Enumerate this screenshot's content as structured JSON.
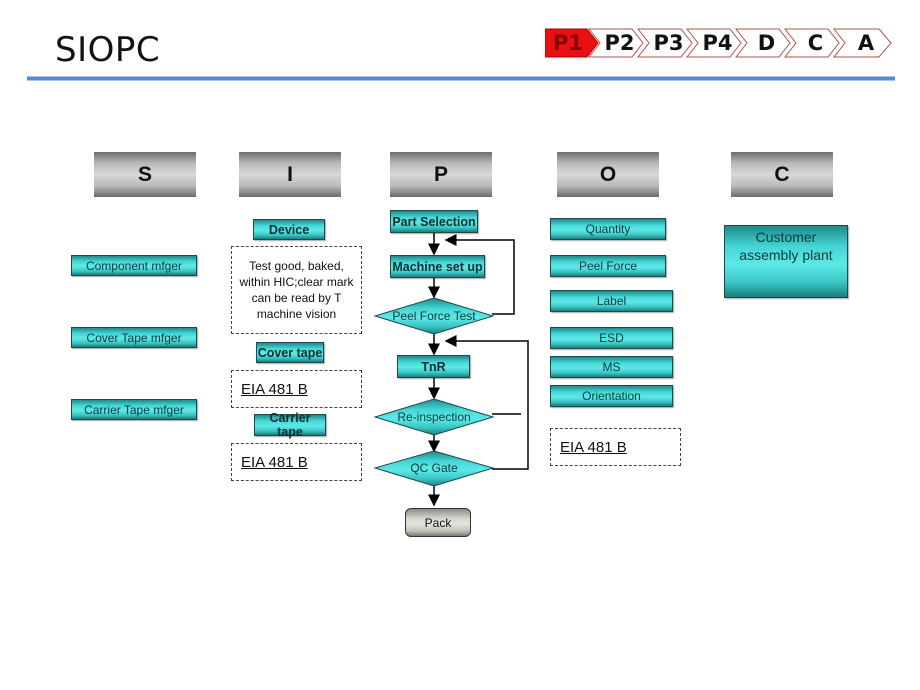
{
  "title": "SIOPC",
  "nav": {
    "items": [
      {
        "label": "P1",
        "active": true
      },
      {
        "label": "P2",
        "active": false
      },
      {
        "label": "P3",
        "active": false
      },
      {
        "label": "P4",
        "active": false
      },
      {
        "label": "D",
        "active": false
      },
      {
        "label": "C",
        "active": false
      },
      {
        "label": "A",
        "active": false
      }
    ],
    "active_color": "#e81010",
    "outline_color": "#b05050"
  },
  "columns": {
    "headers": [
      "S",
      "I",
      "P",
      "O",
      "C"
    ],
    "supplier": {
      "items": [
        "Component mfger",
        "Cover Tape mfger",
        "Carrier Tape mfger"
      ]
    },
    "input": {
      "device_label": "Device",
      "device_note": "Test  good, baked, within HIC;clear mark can be read by T machine vision",
      "cover_tape_label": "Cover tape",
      "cover_tape_spec": "EIA 481 B",
      "carrier_tape_label": "Carrier tape",
      "carrier_tape_spec": "EIA 481 B"
    },
    "process": {
      "steps": [
        "Part Selection",
        "Machine set up",
        "Peel Force Test",
        "TnR",
        "Re-inspection",
        "QC Gate",
        "Pack"
      ]
    },
    "output": {
      "items": [
        "Quantity",
        "Peel Force",
        "Label",
        "ESD",
        "MS",
        "Orientation"
      ],
      "spec": "EIA 481 B"
    },
    "customer": {
      "label": "Customer assembly plant"
    }
  },
  "colors": {
    "teal": "#46d7d7",
    "rule_blue": "#5a88c8",
    "header_grey": "#b9b9b9"
  }
}
